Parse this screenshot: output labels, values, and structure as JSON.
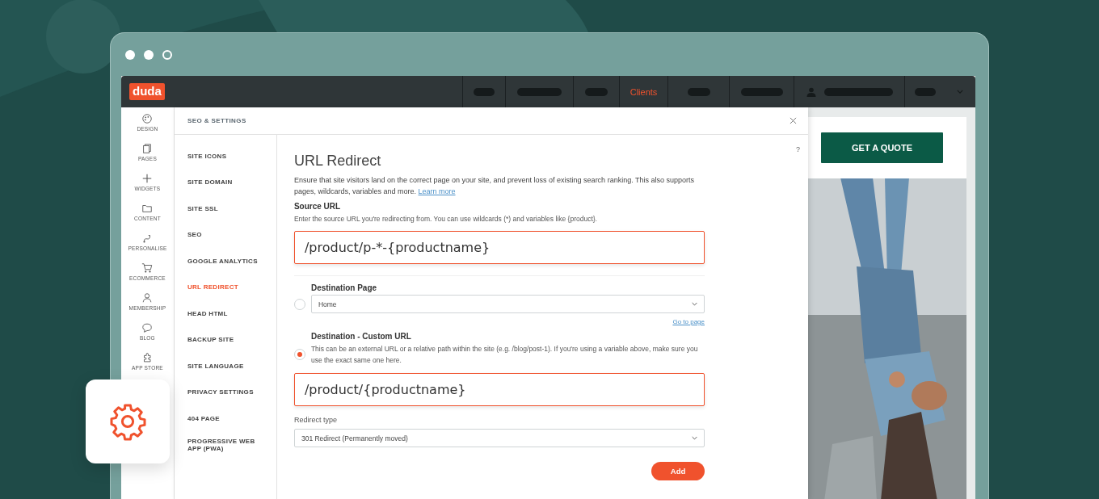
{
  "topbar": {
    "logo": "duda",
    "nav": [
      {
        "kind": "placeholder",
        "selected": false
      },
      {
        "kind": "placeholder",
        "selected": false
      },
      {
        "kind": "placeholder",
        "selected": false
      },
      {
        "kind": "link",
        "label": "Clients",
        "selected": true
      },
      {
        "kind": "placeholder",
        "selected": false
      },
      {
        "kind": "placeholder",
        "selected": false
      },
      {
        "kind": "user",
        "selected": false
      },
      {
        "kind": "placeholder",
        "selected": false
      },
      {
        "kind": "menu",
        "selected": false
      }
    ]
  },
  "rail": [
    {
      "label": "DESIGN"
    },
    {
      "label": "PAGES"
    },
    {
      "label": "WIDGETS"
    },
    {
      "label": "CONTENT"
    },
    {
      "label": "PERSONALISE"
    },
    {
      "label": "ECOMMERCE"
    },
    {
      "label": "MEMBERSHIP"
    },
    {
      "label": "BLOG"
    },
    {
      "label": "APP STORE"
    }
  ],
  "modal": {
    "title": "SEO & SETTINGS",
    "help": "?",
    "nav": [
      {
        "label": "SITE ICONS",
        "selected": false
      },
      {
        "label": "SITE DOMAIN",
        "selected": false
      },
      {
        "label": "SITE SSL",
        "selected": false
      },
      {
        "label": "SEO",
        "selected": false
      },
      {
        "label": "GOOGLE ANALYTICS",
        "selected": false
      },
      {
        "label": "URL REDIRECT",
        "selected": true
      },
      {
        "label": "HEAD HTML",
        "selected": false
      },
      {
        "label": "BACKUP SITE",
        "selected": false
      },
      {
        "label": "SITE LANGUAGE",
        "selected": false
      },
      {
        "label": "PRIVACY SETTINGS",
        "selected": false
      },
      {
        "label": "404 PAGE",
        "selected": false
      },
      {
        "label": "PROGRESSIVE WEB APP (PWA)",
        "selected": false
      }
    ],
    "content": {
      "heading": "URL Redirect",
      "intro": "Ensure that site visitors land on the correct page on your site, and prevent loss of existing search ranking. This also supports pages, wildcards, variables and more.",
      "intro_link": "Learn more",
      "source": {
        "label": "Source URL",
        "hint": "Enter the source URL you're redirecting from. You can use wildcards (*) and variables like {product}.",
        "value": "/product/p-*-{productname}"
      },
      "destination_page": {
        "label": "Destination Page",
        "selected": false,
        "value": "Home",
        "link": "Go to page"
      },
      "destination_custom": {
        "label": "Destination - Custom URL",
        "selected": true,
        "hint": "This can be an external URL or a relative path within the site (e.g. /blog/post-1). If you're using a variable above, make sure you use the exact same one here.",
        "value": "/product/{productname}"
      },
      "redirect_type": {
        "label": "Redirect type",
        "value": "301 Redirect (Permanently moved)"
      },
      "add_button": "Add"
    }
  },
  "preview": {
    "button": "GET A QUOTE"
  }
}
